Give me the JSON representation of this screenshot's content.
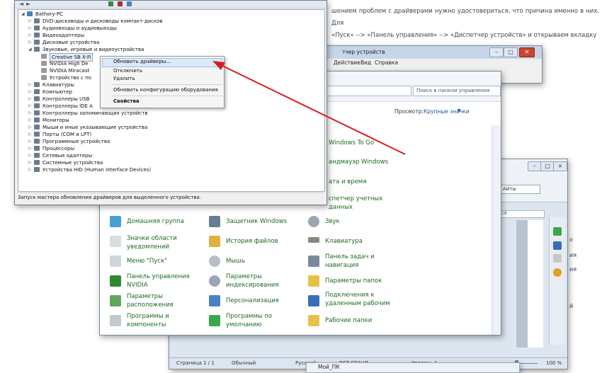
{
  "article": {
    "line1": "шением проблем с драйверами нужно удостовериться, что причина именно в них. Для",
    "line2": "«Пуск» --> «Панель управления» --> «Диспетчер устройств» и открываем вкладку",
    "line3": "ств»."
  },
  "word": {
    "font_combo": "Айты",
    "ruler": "18 ·",
    "status": {
      "page": "Страница  1 / 1",
      "style": "Обычный",
      "lang": "Русский",
      "flags": "ВСТ  СТАНД",
      "level": "Уровень  1",
      "zoom": "100 %"
    }
  },
  "right_text": {
    "a": "о",
    "b": "ия",
    "c": "ия",
    "d": "й"
  },
  "device_manager_back": {
    "title": "тчер устройств",
    "menu": [
      "Действие",
      "Вид",
      "Справка"
    ]
  },
  "control_panel": {
    "search_placeholder": "Поиск в панели управления",
    "view_label": "Просмотр:",
    "view_value": "Крупные значки",
    "right_items": [
      "Windows To Go",
      "андмауэр Windows",
      "ата и время",
      "спетчер учетных данных"
    ],
    "items": [
      {
        "label": "Домашняя группа"
      },
      {
        "label": "Защитник Windows"
      },
      {
        "label": "Звук"
      },
      {
        "label": "Значки области уведомлений"
      },
      {
        "label": "История файлов"
      },
      {
        "label": "Клавиатура"
      },
      {
        "label": "Меню \"Пуск\""
      },
      {
        "label": "Мышь"
      },
      {
        "label": "Панель задач и навигация"
      },
      {
        "label": "Панель управления NVIDIA"
      },
      {
        "label": "Параметры индексирования"
      },
      {
        "label": "Параметры папок"
      },
      {
        "label": "Параметры расположения"
      },
      {
        "label": "Персонализация"
      },
      {
        "label": "Подключения к удаленным рабочим"
      },
      {
        "label": "Программы и компоненты"
      },
      {
        "label": "Программы по умолчанию"
      },
      {
        "label": "Рабочие папки"
      }
    ]
  },
  "device_manager": {
    "root": "Bathory-PC",
    "nodes": [
      "DVD-дисководы и дисководы компакт-дисков",
      "Аудиовходы и аудиовыходы",
      "Видеоадаптеры",
      "Дисковые устройства",
      "Звуковые, игровые и видеоустройства",
      "Creative SB X-Fi",
      "NVIDIA High De",
      "NVIDIA Miracast",
      "Устройство с по",
      "Клавиатуры",
      "Компьютер",
      "Контроллеры USB",
      "Контроллеры IDE A",
      "Контроллеры запоминающих устройств",
      "Мониторы",
      "Мыши и иные указывающие устройства",
      "Порты (COM и LPT)",
      "Программные устройства",
      "Процессоры",
      "Сетевые адаптеры",
      "Системные устройства",
      "Устройства HID (Human Interface Devices)"
    ],
    "status": "Запуск мастера обновления драйверов для выделенного устройства."
  },
  "context_menu": {
    "items": [
      "Обновить драйверы...",
      "Отключить",
      "Удалить",
      "Обновить конфигурацию оборудования",
      "Свойства"
    ]
  },
  "explorer": {
    "label": "Мой_ПК"
  },
  "colors": {
    "link_green": "#1a6a1f",
    "arrow_red": "#d62020",
    "selection": "#dbe8f6"
  }
}
